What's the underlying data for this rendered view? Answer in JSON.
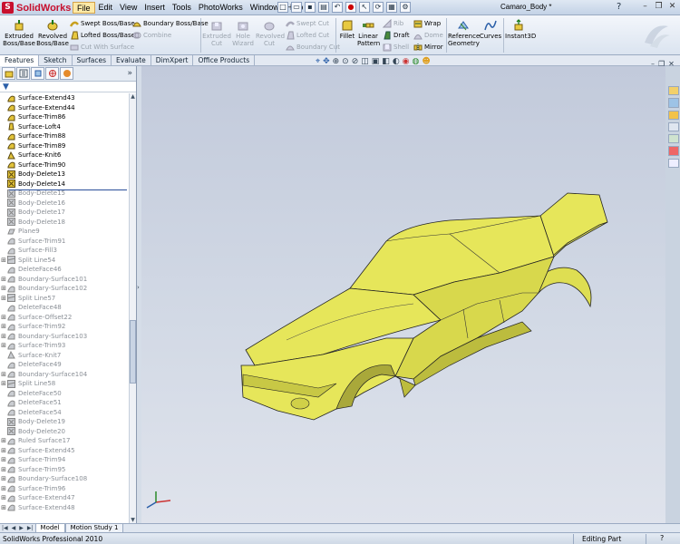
{
  "app": {
    "logo_text": "SolidWorks",
    "doc_title": "Camaro_Body *"
  },
  "menus": [
    "File",
    "Edit",
    "View",
    "Insert",
    "Tools",
    "PhotoWorks",
    "Window",
    "Help"
  ],
  "help_icon": "?",
  "ribbon": {
    "extruded_boss": "Extruded Boss/Base",
    "revolved_boss": "Revolved Boss/Base",
    "swept_boss": "Swept Boss/Base",
    "lofted_boss": "Lofted Boss/Base",
    "boundary_boss": "Boundary Boss/Base",
    "cut_with_surface": "Cut With Surface",
    "combine": "Combine",
    "extruded_cut": "Extruded Cut",
    "hole_wizard": "Hole Wizard",
    "revolved_cut": "Revolved Cut",
    "swept_cut": "Swept Cut",
    "lofted_cut": "Lofted Cut",
    "boundary_cut": "Boundary Cut",
    "fillet": "Fillet",
    "linear_pattern": "Linear Pattern",
    "rib": "Rib",
    "draft": "Draft",
    "shell": "Shell",
    "wrap": "Wrap",
    "dome": "Dome",
    "mirror": "Mirror",
    "reference_geometry": "Reference Geometry",
    "curves": "Curves",
    "instant3d": "Instant3D"
  },
  "command_tabs": [
    "Features",
    "Sketch",
    "Surfaces",
    "Evaluate",
    "DimXpert",
    "Office Products"
  ],
  "manager_chevron": "»",
  "tree": {
    "active": [
      "Surface-Extend43",
      "Surface-Extend44",
      "Surface-Trim86",
      "Surface-Loft4",
      "Surface-Trim88",
      "Surface-Trim89",
      "Surface-Knit6",
      "Surface-Trim90",
      "Body-Delete13",
      "Body-Delete14"
    ],
    "suppressed": [
      "Body-Delete15",
      "Body-Delete16",
      "Body-Delete17",
      "Body-Delete18",
      "Plane9",
      "Surface-Trim91",
      "Surface-Fill3",
      "Split Line54",
      "DeleteFace46",
      "Boundary-Surface101",
      "Boundary-Surface102",
      "Split Line57",
      "DeleteFace48",
      "Surface-Offset22",
      "Surface-Trim92",
      "Boundary-Surface103",
      "Surface-Trim93",
      "Surface-Knit7",
      "DeleteFace49",
      "Boundary-Surface104",
      "Split Line58",
      "DeleteFace50",
      "DeleteFace51",
      "DeleteFace54",
      "Body-Delete19",
      "Body-Delete20",
      "Ruled Surface17",
      "Surface-Extend45",
      "Surface-Trim94",
      "Surface-Trim95",
      "Boundary-Surface108",
      "Surface-Trim96",
      "Surface-Extend47",
      "Surface-Extend48"
    ]
  },
  "bottom_tabs": [
    "Model",
    "Motion Study 1"
  ],
  "status": {
    "left": "SolidWorks Professional 2010",
    "right": "Editing Part",
    "help": "?"
  },
  "colors": {
    "body_yellow": "#e6e65a",
    "body_shadow": "#a9a83a",
    "viewport_top": "#c2cadb",
    "rollback_bar": "#2a4f9a"
  }
}
